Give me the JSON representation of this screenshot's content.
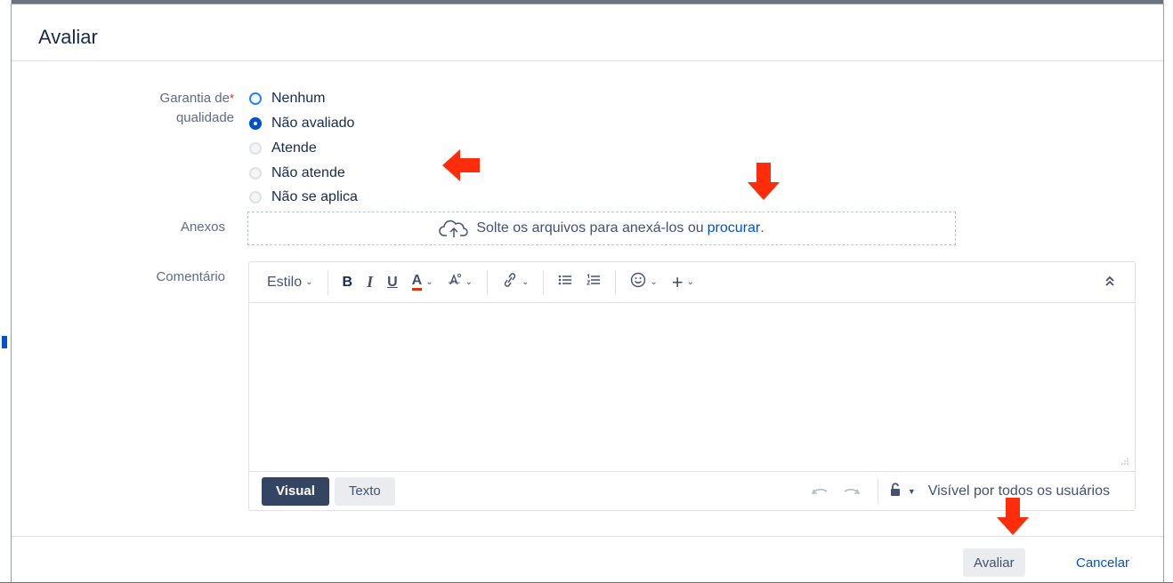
{
  "dialog": {
    "title": "Avaliar"
  },
  "quality": {
    "label_line1": "Garantia de",
    "label_line2": "qualidade",
    "required_mark": "*",
    "options": [
      {
        "label": "Nenhum",
        "state": "hover"
      },
      {
        "label": "Não avaliado",
        "state": "selected"
      },
      {
        "label": "Atende",
        "state": "unselected"
      },
      {
        "label": "Não atende",
        "state": "unselected"
      },
      {
        "label": "Não se aplica",
        "state": "unselected"
      }
    ]
  },
  "attachments": {
    "label": "Anexos",
    "drop_text": "Solte os arquivos para anexá-los ou",
    "browse_link": "procurar",
    "period": "."
  },
  "comment": {
    "label": "Comentário",
    "toolbar": {
      "style_label": "Estilo",
      "bold": "B",
      "italic": "I",
      "underline": "U",
      "text_color": "A",
      "plus": "+"
    },
    "modes": {
      "visual": "Visual",
      "text": "Texto"
    },
    "visibility": "Visível por todos os usuários"
  },
  "footer": {
    "submit_label": "Avaliar",
    "cancel_label": "Cancelar"
  },
  "colors": {
    "accent": "#0052cc",
    "annotation_arrow": "#ff2d0a",
    "primary_dark": "#344563"
  }
}
